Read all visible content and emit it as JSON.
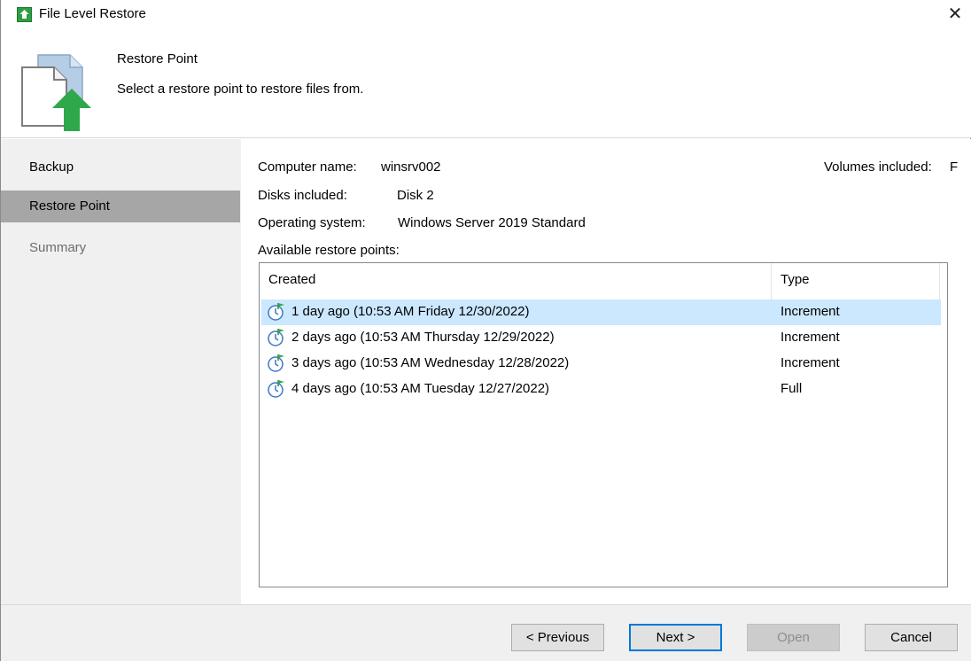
{
  "window": {
    "title": "File Level Restore",
    "close_glyph": "✕"
  },
  "header": {
    "title": "Restore Point",
    "description": "Select a restore point to restore files from."
  },
  "sidebar": {
    "items": [
      {
        "label": "Backup",
        "state": "normal"
      },
      {
        "label": "Restore Point",
        "state": "active"
      },
      {
        "label": "Summary",
        "state": "disabled"
      }
    ]
  },
  "info": {
    "computer_name_label": "Computer name:",
    "computer_name_value": "winsrv002",
    "disks_label": "Disks included:",
    "disks_value": "Disk 2",
    "os_label": "Operating system:",
    "os_value": "Windows Server 2019 Standard",
    "volumes_label": "Volumes included:",
    "volumes_value": "F",
    "available_label": "Available restore points:"
  },
  "restore_points": {
    "columns": [
      "Created",
      "Type"
    ],
    "rows": [
      {
        "created": "1 day ago (10:53 AM Friday 12/30/2022)",
        "type": "Increment",
        "selected": true
      },
      {
        "created": "2 days ago (10:53 AM Thursday 12/29/2022)",
        "type": "Increment",
        "selected": false
      },
      {
        "created": "3 days ago (10:53 AM Wednesday 12/28/2022)",
        "type": "Increment",
        "selected": false
      },
      {
        "created": "4 days ago (10:53 AM Tuesday 12/27/2022)",
        "type": "Full",
        "selected": false
      }
    ]
  },
  "footer": {
    "previous_label": "< Previous",
    "next_label": "Next >",
    "open_label": "Open",
    "cancel_label": "Cancel"
  },
  "colors": {
    "accent": "#0078d7",
    "selection": "#cce8ff",
    "brand_green": "#2e9e44",
    "nav_active": "#a6a6a6"
  }
}
